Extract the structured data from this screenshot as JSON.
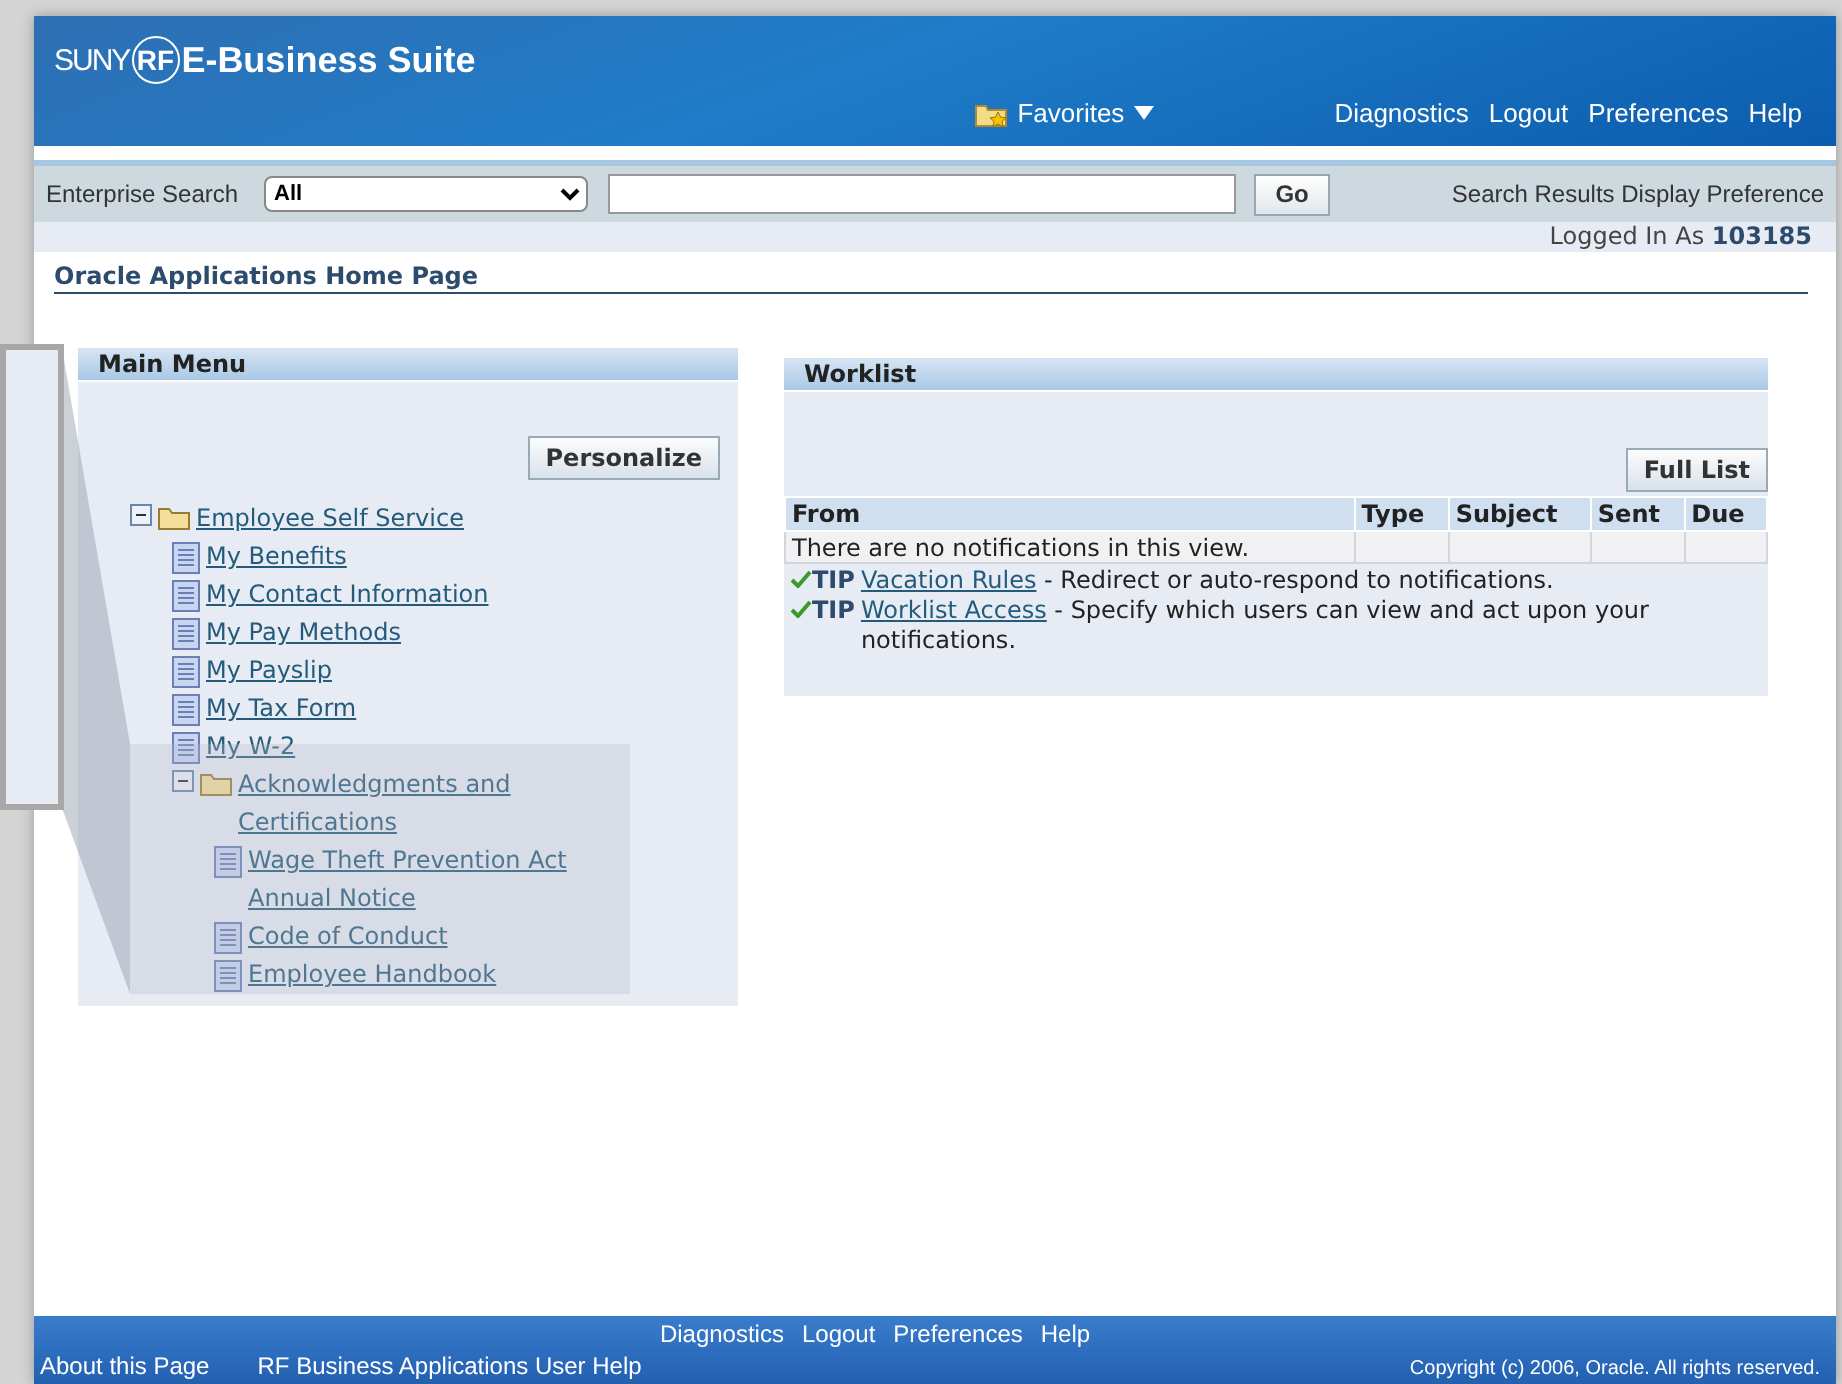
{
  "header": {
    "logo": {
      "prefix": "SUNY",
      "emblem": "RF",
      "title": "E-Business Suite"
    },
    "favorites": "Favorites",
    "global_links": [
      "Diagnostics",
      "Logout",
      "Preferences",
      "Help"
    ]
  },
  "search": {
    "label": "Enterprise Search",
    "scope": "All",
    "button": "Go",
    "preference_link": "Search Results Display Preference"
  },
  "login": {
    "label": "Logged In As",
    "user": "103185"
  },
  "page_title": "Oracle Applications Home Page",
  "main_menu": {
    "title": "Main Menu",
    "button": "Personalize",
    "items": [
      {
        "kind": "folder",
        "label": "Employee Self Service",
        "expanded": true,
        "children": [
          {
            "kind": "page",
            "label": "My Benefits"
          },
          {
            "kind": "page",
            "label": "My Contact Information"
          },
          {
            "kind": "page",
            "label": "My Pay Methods"
          },
          {
            "kind": "page",
            "label": "My Payslip"
          },
          {
            "kind": "page",
            "label": "My Tax Form"
          },
          {
            "kind": "page",
            "label": "My W-2"
          },
          {
            "kind": "folder",
            "label": "Acknowledgments and Certifications",
            "expanded": true,
            "children": [
              {
                "kind": "page",
                "label": "Wage Theft Prevention Act Annual Notice"
              },
              {
                "kind": "page",
                "label": "Code of Conduct"
              },
              {
                "kind": "page",
                "label": "Employee Handbook"
              }
            ]
          }
        ]
      }
    ]
  },
  "worklist": {
    "title": "Worklist",
    "button": "Full List",
    "columns": [
      "From",
      "Type",
      "Subject",
      "Sent",
      "Due"
    ],
    "empty_message": "There are no notifications in this view.",
    "tips": [
      {
        "label": "TIP",
        "link": "Vacation Rules",
        "text": "- Redirect or auto-respond to notifications."
      },
      {
        "label": "TIP",
        "link": "Worklist Access",
        "text": "- Specify which users can view and act upon your notifications."
      }
    ]
  },
  "footer": {
    "links": [
      "Diagnostics",
      "Logout",
      "Preferences",
      "Help"
    ],
    "bottom_links": [
      "About this Page",
      "RF Business Applications User Help"
    ],
    "copyright": "Copyright (c) 2006, Oracle. All rights reserved."
  }
}
